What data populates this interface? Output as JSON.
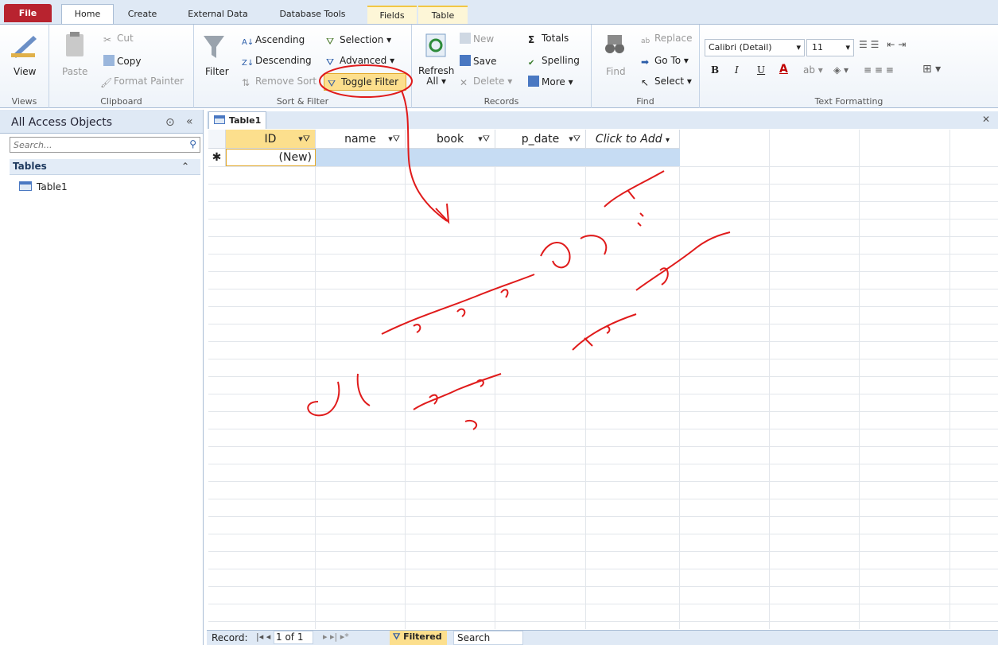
{
  "tabs": [
    "File",
    "Home",
    "Create",
    "External Data",
    "Database Tools",
    "Fields",
    "Table"
  ],
  "ribbon": {
    "views": {
      "view": "View",
      "label": "Views"
    },
    "clipboard": {
      "paste": "Paste",
      "cut": "Cut",
      "copy": "Copy",
      "format_painter": "Format Painter",
      "label": "Clipboard"
    },
    "sort_filter": {
      "filter": "Filter",
      "ascending": "Ascending",
      "descending": "Descending",
      "remove_sort": "Remove Sort",
      "selection": "Selection",
      "advanced": "Advanced",
      "toggle_filter": "Toggle Filter",
      "label": "Sort & Filter"
    },
    "records": {
      "refresh": "Refresh",
      "all": "All",
      "new": "New",
      "save": "Save",
      "delete": "Delete",
      "totals": "Totals",
      "spelling": "Spelling",
      "more": "More",
      "label": "Records"
    },
    "find": {
      "find": "Find",
      "replace": "Replace",
      "goto": "Go To",
      "select": "Select",
      "label": "Find"
    },
    "text_formatting": {
      "font": "Calibri (Detail)",
      "size": "11",
      "label": "Text Formatting"
    }
  },
  "nav_pane": {
    "title": "All Access Objects",
    "search_placeholder": "Search...",
    "group": "Tables",
    "items": [
      "Table1"
    ]
  },
  "document": {
    "tab": "Table1",
    "columns": [
      "ID",
      "name",
      "book",
      "p_date",
      "Click to Add"
    ],
    "new_row_value": "(New)"
  },
  "status": {
    "record_label": "Record:",
    "record_value": "1 of 1",
    "filtered": "Filtered",
    "search": "Search"
  },
  "colors": {
    "file_tab": "#b8232f",
    "annotation": "#e01b1b",
    "highlight": "#fcdf8d"
  }
}
